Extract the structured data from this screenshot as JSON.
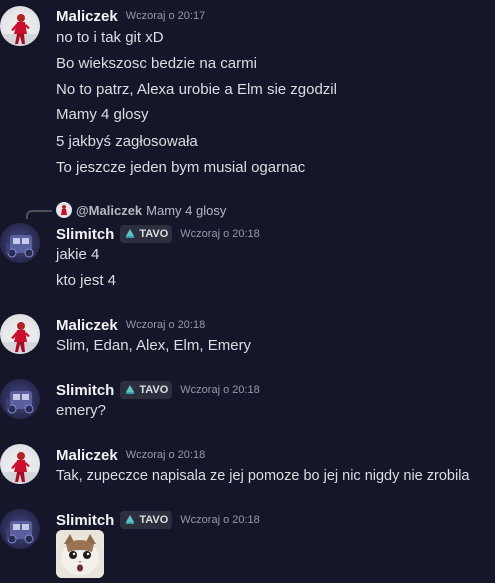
{
  "messages": [
    {
      "author": "Maliczek",
      "timestamp": "Wczoraj o 20:17",
      "lines": [
        "no to i tak git xD",
        "Bo wiekszosc bedzie na carmi",
        "No to patrz, Alexa urobie a Elm sie zgodzil",
        "Mamy 4 glosy",
        "5 jakbyś zagłosowała",
        "To jeszcze jeden bym musial ogarnac"
      ]
    },
    {
      "reply": {
        "author": "@Maliczek",
        "text": "Mamy 4 glosy"
      },
      "author": "Slimitch",
      "tag": "TAVO",
      "timestamp": "Wczoraj o 20:18",
      "lines": [
        "jakie 4",
        "kto jest 4"
      ]
    },
    {
      "author": "Maliczek",
      "timestamp": "Wczoraj o 20:18",
      "lines": [
        "Slim, Edan, Alex, Elm, Emery"
      ]
    },
    {
      "author": "Slimitch",
      "tag": "TAVO",
      "timestamp": "Wczoraj o 20:18",
      "lines": [
        "emery?"
      ]
    },
    {
      "author": "Maliczek",
      "timestamp": "Wczoraj o 20:18",
      "lines": [
        "Tak, zupeczce napisala ze jej pomoze bo jej nic nigdy nie zrobila"
      ]
    },
    {
      "author": "Slimitch",
      "tag": "TAVO",
      "timestamp": "Wczoraj o 20:18",
      "attachment": "cat-emoji"
    }
  ],
  "colors": {
    "background": "#16162a",
    "username": "#f2f3f5",
    "text": "#dbdee1",
    "timestamp": "#949ba4",
    "tag_icon": "#5fc3c9"
  }
}
